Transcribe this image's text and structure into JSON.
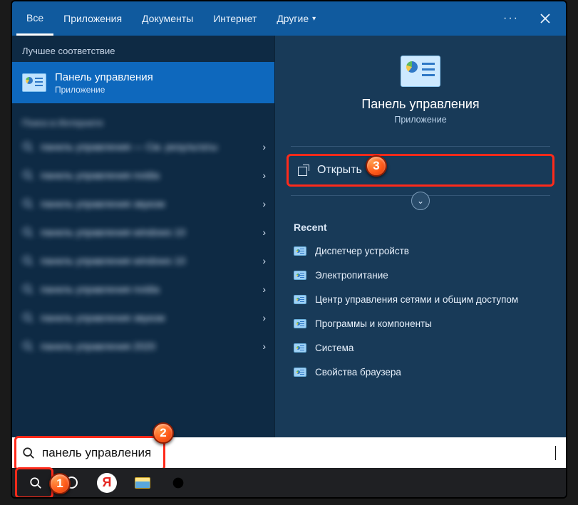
{
  "tabs": {
    "all": "Все",
    "apps": "Приложения",
    "docs": "Документы",
    "internet": "Интернет",
    "other": "Другие"
  },
  "left": {
    "best_label": "Лучшее соответствие",
    "best_title": "Панель управления",
    "best_sub": "Приложение",
    "sugg_header": "Поиск в Интернете",
    "suggestions": [
      "панель управления — См. результаты",
      "панель управления nvidia",
      "панель управления звуком",
      "панель управления windows 10",
      "панель управления windows 10",
      "панель управления nvidia",
      "панель управления звуком",
      "панель управления 2020"
    ]
  },
  "right": {
    "title": "Панель управления",
    "sub": "Приложение",
    "open": "Открыть",
    "recent_label": "Recent",
    "recent": [
      "Диспетчер устройств",
      "Электропитание",
      "Центр управления сетями и общим доступом",
      "Программы и компоненты",
      "Система",
      "Свойства браузера"
    ]
  },
  "search": {
    "value": "панель управления"
  },
  "markers": {
    "m1": "1",
    "m2": "2",
    "m3": "3"
  }
}
